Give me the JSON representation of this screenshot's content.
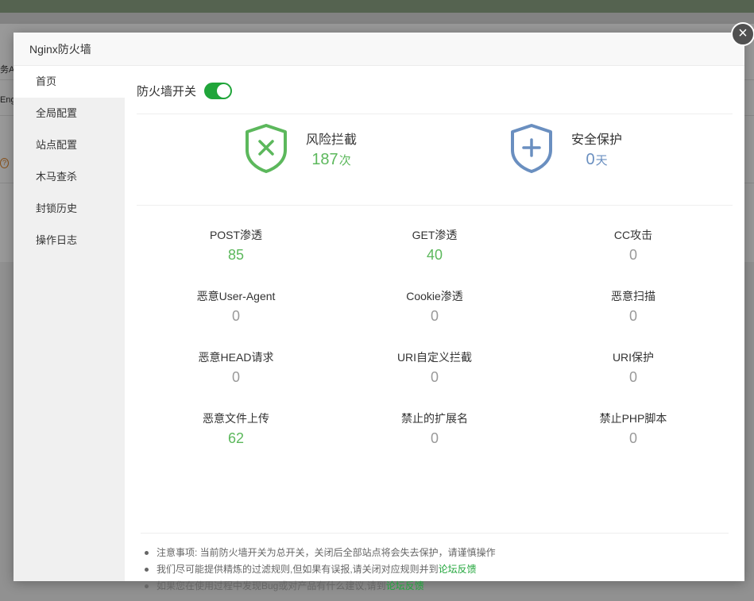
{
  "background": {
    "frag1": "务Ap",
    "frag2": "Eng",
    "help_glyph": "?"
  },
  "modal": {
    "title": "Nginx防火墙",
    "close_glyph": "×"
  },
  "sidebar": {
    "items": [
      {
        "label": "首页",
        "active": true
      },
      {
        "label": "全局配置",
        "active": false
      },
      {
        "label": "站点配置",
        "active": false
      },
      {
        "label": "木马查杀",
        "active": false
      },
      {
        "label": "封锁历史",
        "active": false
      },
      {
        "label": "操作日志",
        "active": false
      }
    ]
  },
  "main": {
    "switch_label": "防火墙开关",
    "switch_on": true,
    "risk": {
      "label": "风险拦截",
      "value": "187",
      "unit": "次",
      "color": "#5cb85c",
      "icon": "shield-x-icon"
    },
    "protect": {
      "label": "安全保护",
      "value": "0",
      "unit": "天",
      "color": "#6a8fc0",
      "icon": "shield-plus-icon"
    },
    "stats": [
      {
        "name": "POST渗透",
        "value": "85",
        "color": "green"
      },
      {
        "name": "GET渗透",
        "value": "40",
        "color": "green"
      },
      {
        "name": "CC攻击",
        "value": "0",
        "color": "gray"
      },
      {
        "name": "恶意User-Agent",
        "value": "0",
        "color": "gray"
      },
      {
        "name": "Cookie渗透",
        "value": "0",
        "color": "gray"
      },
      {
        "name": "恶意扫描",
        "value": "0",
        "color": "gray"
      },
      {
        "name": "恶意HEAD请求",
        "value": "0",
        "color": "gray"
      },
      {
        "name": "URI自定义拦截",
        "value": "0",
        "color": "gray"
      },
      {
        "name": "URI保护",
        "value": "0",
        "color": "gray"
      },
      {
        "name": "恶意文件上传",
        "value": "62",
        "color": "green"
      },
      {
        "name": "禁止的扩展名",
        "value": "0",
        "color": "gray"
      },
      {
        "name": "禁止PHP脚本",
        "value": "0",
        "color": "gray"
      }
    ],
    "notes": [
      {
        "text": "注意事项: 当前防火墙开关为总开关，关闭后全部站点将会失去保护，请谨慎操作",
        "link": ""
      },
      {
        "text": "我们尽可能提供精炼的过滤规则,但如果有误报,请关闭对应规则并到",
        "link": "论坛反馈"
      },
      {
        "text": "如果您在使用过程中发现Bug或对产品有什么建议,请到",
        "link": "论坛反馈"
      }
    ]
  }
}
